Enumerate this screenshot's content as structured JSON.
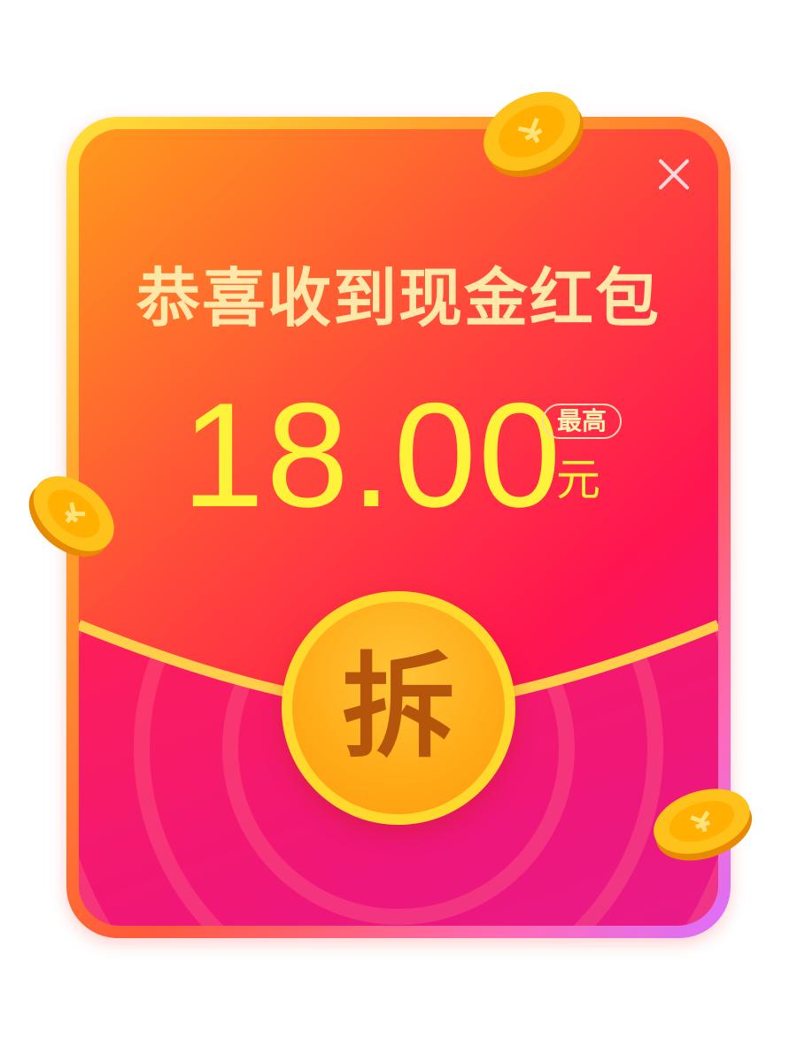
{
  "dialog": {
    "headline": "恭喜收到现金红包",
    "amount": "18.00",
    "max_badge": "最高",
    "unit": "元",
    "open_button_label": "拆",
    "close_icon": "close-icon"
  },
  "colors": {
    "envelope_red": "#ff1f55",
    "headline_gold": "#ffe7a8",
    "amount_yellow": "#fff23a",
    "open_button_gold": "#ffaa16",
    "open_button_text": "#b5540b"
  },
  "decorations": {
    "coin_icon": "gold-coin-icon"
  }
}
